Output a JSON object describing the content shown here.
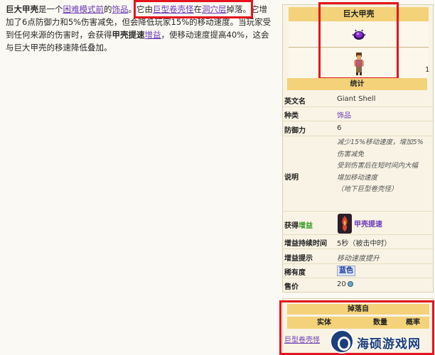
{
  "article": {
    "l1_name": "巨大甲壳",
    "l1_t1": "是一个",
    "l1_link_mode": "困难模式前",
    "l1_t2": "的",
    "l1_link_acc": "饰品",
    "l1_t3": "。它由",
    "l1_link_npc": "巨型卷壳怪",
    "l1_t4": "在",
    "l1_link_cave": "洞穴层",
    "l1_t5": "掉落。它增",
    "l2": "加了6点防御力和5%伤害减免，但会降低玩家15%的移动速度。当玩家受",
    "l3_t1": "到任何来源的伤害时，会获得",
    "l3_bold": "甲壳提速",
    "l3_link": "增益",
    "l3_t2": "，使移动速度提高40%，这会",
    "l4": "与巨大甲壳的移速降低叠加。"
  },
  "infobox": {
    "title": "巨大甲壳",
    "count": "1",
    "stats_header": "统计",
    "labels": {
      "en": "英文名",
      "type": "种类",
      "defense": "防御力",
      "desc": "说明",
      "buff": "获得",
      "buff_green": "增益",
      "duration": "增益持续时间",
      "tooltip": "增益提示",
      "rarity": "稀有度",
      "price": "售价"
    },
    "values": {
      "en": "Giant Shell",
      "type": "饰品",
      "defense": "6",
      "desc_lines": [
        "减少15%移动速度，增加5%",
        "伤害减免",
        "受到伤害后在短时间内大幅",
        "增加移动速度",
        "（地下巨型卷壳怪）"
      ],
      "buff_name": "甲壳提速",
      "duration": "5秒（被击中时）",
      "tooltip": "移动速度提升",
      "rarity": "蓝色",
      "price": "20"
    }
  },
  "drops": {
    "header": "掉落自",
    "col_entity": "实体",
    "col_qty": "数量",
    "col_rate": "概率",
    "entity": "巨型卷壳怪"
  },
  "watermark": {
    "text": "海硕游戏网"
  },
  "colors": {
    "header_gold": "#f3d27a",
    "link_purple": "#6a3bb4",
    "highlight_red": "#e4141e",
    "panel_bg": "#f8f3e4"
  }
}
